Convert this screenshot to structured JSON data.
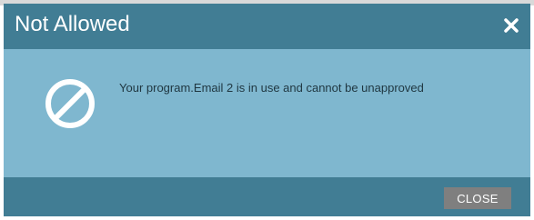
{
  "dialog": {
    "title": "Not Allowed",
    "message": "Your program.Email 2 is in use and cannot be unapproved",
    "close_button_label": "CLOSE",
    "icons": {
      "close": "close-icon",
      "status": "prohibited-icon"
    }
  },
  "colors": {
    "header_footer": "#417d94",
    "body": "#7fb7cf",
    "button": "#7f7f7f",
    "text_light": "#ffffff",
    "text_dark": "#1f3640"
  }
}
